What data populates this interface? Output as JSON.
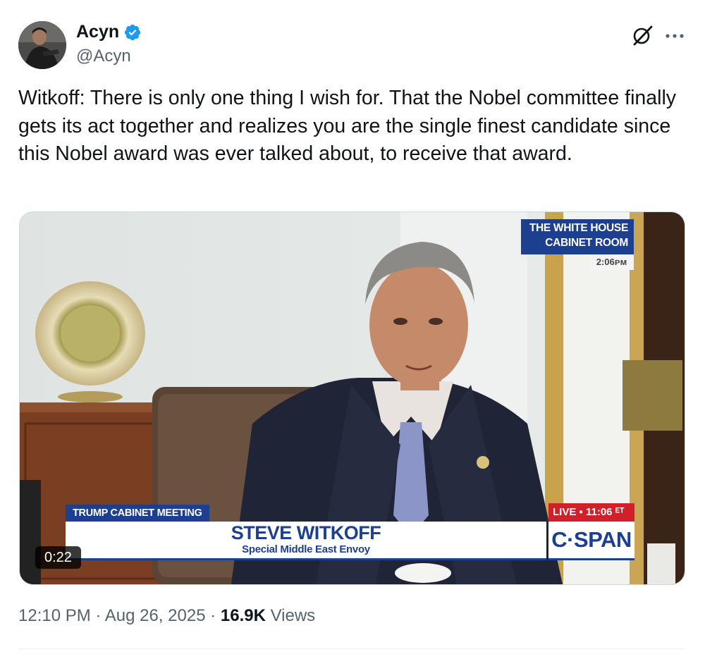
{
  "author": {
    "display_name": "Acyn",
    "handle": "@Acyn",
    "verified": true,
    "verified_color": "#1d9bf0",
    "avatar": "avatar-photo"
  },
  "header_actions": {
    "grok_icon": "grok-icon",
    "more_icon": "more-dots-icon"
  },
  "tweet": {
    "text": "Witkoff: There is only one thing I wish for. That the Nobel committee finally gets its act together and realizes you are the single finest candidate since this Nobel award was ever talked about, to receive that award."
  },
  "video": {
    "duration": "0:22",
    "bug_line1": "THE WHITE HOUSE",
    "bug_line2": "CABINET ROOM",
    "bug_time": "2:06ᴘᴍ",
    "lower_tag": "TRUMP CABINET MEETING",
    "lower_name": "STEVE WITKOFF",
    "lower_title": "Special Middle East Envoy",
    "live_label": "LIVE ▪ 11:06 ᴱᵀ",
    "network": "C·SPAN",
    "brand_color": "#1d3f8f",
    "live_color": "#d0202a"
  },
  "meta": {
    "time": "12:10 PM",
    "separator": " · ",
    "date": "Aug 26, 2025",
    "views_count": "16.9K",
    "views_label": "Views"
  }
}
